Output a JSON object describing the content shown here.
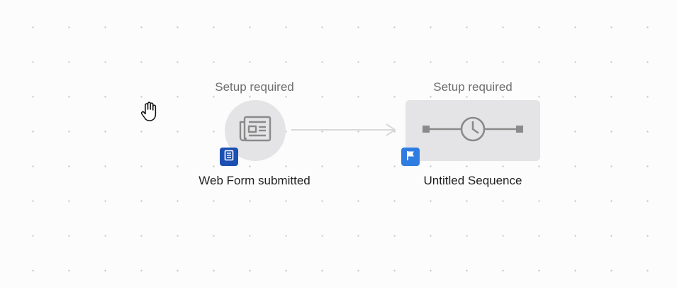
{
  "canvas": {
    "nodes": [
      {
        "status": "Setup required",
        "label": "Web Form submitted",
        "icon": "newspaper-icon",
        "badge_icon": "form-icon",
        "badge_color": "#1c4fb3"
      },
      {
        "status": "Setup required",
        "label": "Untitled Sequence",
        "icon": "clock-timeline-icon",
        "badge_icon": "flag-icon",
        "badge_color": "#2f7de1"
      }
    ],
    "connector_icon": "arrow-right-icon",
    "cursor_icon": "hand-grab-icon",
    "colors": {
      "node_fill": "#e4e4e6",
      "icon_stroke": "#8a8a8a",
      "connector": "#d9d9d9",
      "status_text": "#6e6e6e",
      "label_text": "#1f1f1f"
    }
  }
}
